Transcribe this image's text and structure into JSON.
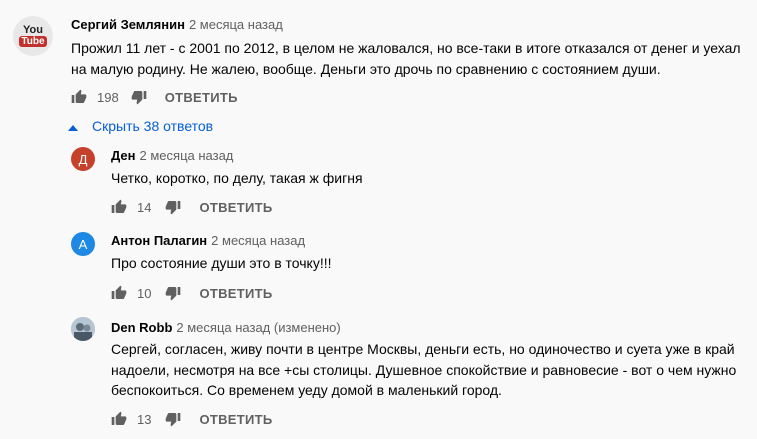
{
  "top_comment": {
    "author": "Сергий Землянин",
    "time": "2 месяца назад",
    "text_lines": [
      "Прожил 11 лет - с 2001 по 2012, в целом не жаловался, но все-таки в итоге отказался от денег и уехал",
      "на малую родину. Не жалею, вообще. Деньги это дрочь по сравнению с состоянием души."
    ],
    "likes": "198",
    "reply_label": "ОТВЕТИТЬ",
    "avatar_logo_top": "You",
    "avatar_logo_bottom": "Tube"
  },
  "toggle_label": "Скрыть 38 ответов",
  "replies": [
    {
      "author": "Ден",
      "time": "2 месяца назад",
      "avatar_letter": "Д",
      "avatar_color": "#c5412b",
      "text_lines": [
        "Четко, коротко, по делу, такая ж фигня"
      ],
      "likes": "14",
      "reply_label": "ОТВЕТИТЬ"
    },
    {
      "author": "Антон Палагин",
      "time": "2 месяца назад",
      "avatar_letter": "А",
      "avatar_color": "#1e88e5",
      "text_lines": [
        "Про состояние души это в точку!!!"
      ],
      "likes": "10",
      "reply_label": "ОТВЕТИТЬ"
    },
    {
      "author": "Den Robb",
      "time": "2 месяца назад (изменено)",
      "text_lines": [
        "Сергей, согласен, живу почти в центре Москвы, деньги есть, но одиночество и суета уже в край",
        "надоели, несмотря на все +сы столицы. Душевное спокойствие и равновесие - вот о чем нужно",
        "беспокоиться. Со временем уеду домой в маленький город."
      ],
      "likes": "13",
      "reply_label": "ОТВЕТИТЬ"
    }
  ],
  "colors": {
    "link": "#065fd4",
    "secondary": "#606060",
    "background": "#f9f9f9"
  },
  "icons": [
    "thumb-up-icon",
    "thumb-down-icon",
    "chevron-up-icon"
  ]
}
